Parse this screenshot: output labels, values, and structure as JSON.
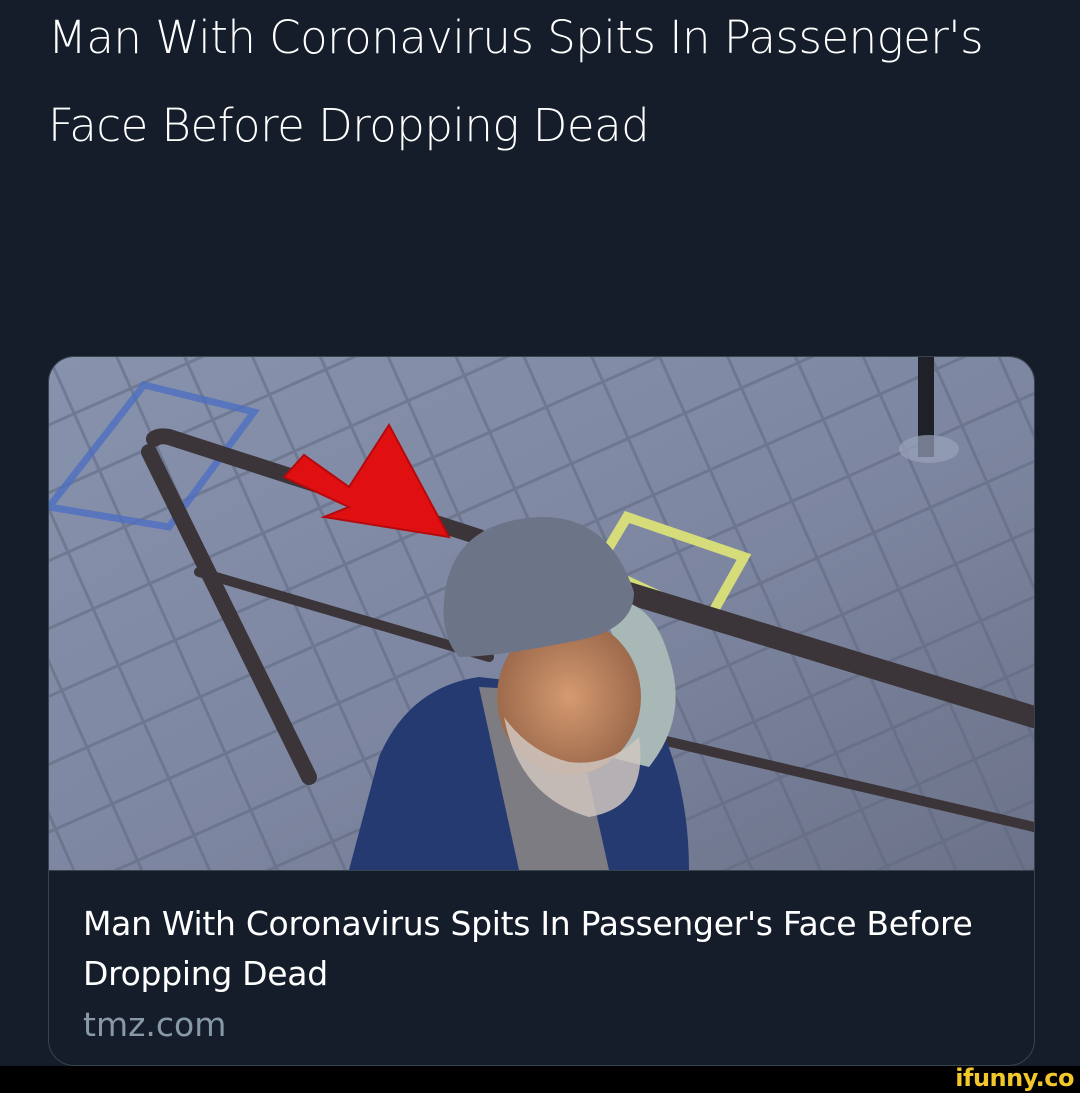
{
  "tweet": {
    "text": "Man With Coronavirus Spits In Passenger's Face Before Dropping Dead"
  },
  "link_card": {
    "title": "Man With Coronavirus Spits In Passenger's Face Before Dropping Dead",
    "domain": "tmz.com"
  },
  "watermark": {
    "text": "ifunny.co"
  },
  "colors": {
    "background": "#151d2b",
    "text": "#ffffff",
    "secondary_text": "#8899a6",
    "card_border": "#38444d",
    "arrow": "#e00f12",
    "watermark": "#f2c72a"
  }
}
